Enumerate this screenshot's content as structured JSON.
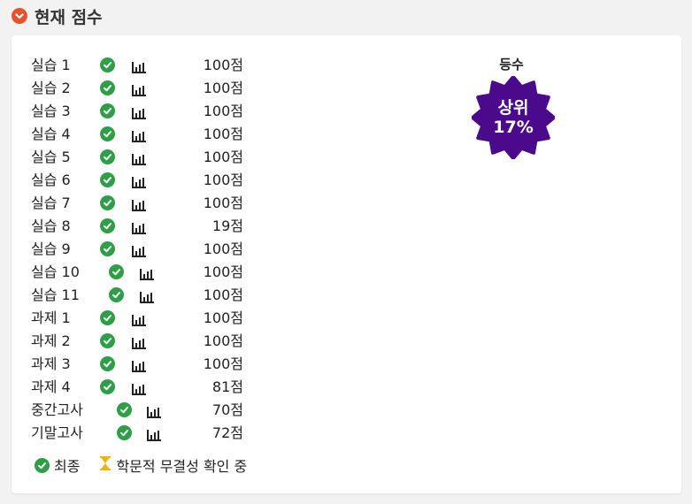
{
  "header": {
    "title": "현재 점수"
  },
  "rows": [
    {
      "label": "실습 1",
      "score": "100점"
    },
    {
      "label": "실습 2",
      "score": "100점"
    },
    {
      "label": "실습 3",
      "score": "100점"
    },
    {
      "label": "실습 4",
      "score": "100점"
    },
    {
      "label": "실습 5",
      "score": "100점"
    },
    {
      "label": "실습 6",
      "score": "100점"
    },
    {
      "label": "실습 7",
      "score": "100점"
    },
    {
      "label": "실습 8",
      "score": "19점"
    },
    {
      "label": "실습 9",
      "score": "100점"
    },
    {
      "label": "실습 10",
      "score": "100점"
    },
    {
      "label": "실습 11",
      "score": "100점"
    },
    {
      "label": "과제 1",
      "score": "100점"
    },
    {
      "label": "과제 2",
      "score": "100점"
    },
    {
      "label": "과제 3",
      "score": "100점"
    },
    {
      "label": "과제 4",
      "score": "81점"
    },
    {
      "label": "중간고사",
      "score": "70점"
    },
    {
      "label": "기말고사",
      "score": "72점"
    }
  ],
  "legend": {
    "final": "최종",
    "pending": "학문적 무결성 확인 중"
  },
  "rank": {
    "label": "등수",
    "line1": "상위",
    "line2": "17%"
  },
  "colors": {
    "check": "#2e9e47",
    "chevron": "#e5532d",
    "badge": "#4b0a8c",
    "hourglass": "#f0b400"
  }
}
